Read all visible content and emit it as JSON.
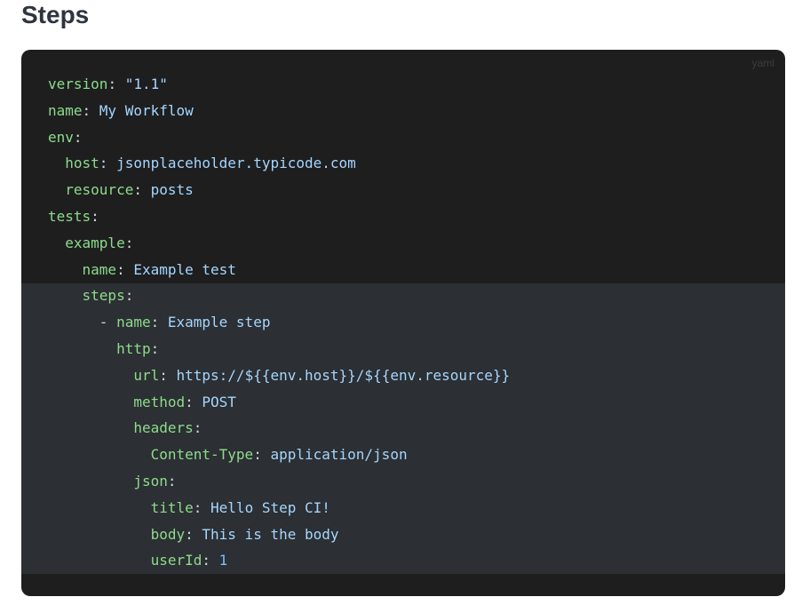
{
  "page": {
    "heading": "Steps"
  },
  "code_block": {
    "language": "yaml",
    "lines": [
      {
        "indent": "",
        "dash": "",
        "key": "version",
        "sep": ": ",
        "value": "\"1.1\"",
        "value_type": "string"
      },
      {
        "indent": "",
        "dash": "",
        "key": "name",
        "sep": ": ",
        "value": "My Workflow",
        "value_type": "string"
      },
      {
        "indent": "",
        "dash": "",
        "key": "env",
        "sep": ":",
        "value": "",
        "value_type": "none"
      },
      {
        "indent": "  ",
        "dash": "",
        "key": "host",
        "sep": ": ",
        "value": "jsonplaceholder.typicode.com",
        "value_type": "string"
      },
      {
        "indent": "  ",
        "dash": "",
        "key": "resource",
        "sep": ": ",
        "value": "posts",
        "value_type": "string"
      },
      {
        "indent": "",
        "dash": "",
        "key": "tests",
        "sep": ":",
        "value": "",
        "value_type": "none"
      },
      {
        "indent": "  ",
        "dash": "",
        "key": "example",
        "sep": ":",
        "value": "",
        "value_type": "none"
      },
      {
        "indent": "    ",
        "dash": "",
        "key": "name",
        "sep": ": ",
        "value": "Example test",
        "value_type": "string"
      },
      {
        "indent": "    ",
        "dash": "",
        "key": "steps",
        "sep": ":",
        "value": "",
        "value_type": "none"
      },
      {
        "indent": "      ",
        "dash": "- ",
        "key": "name",
        "sep": ": ",
        "value": "Example step",
        "value_type": "string"
      },
      {
        "indent": "        ",
        "dash": "",
        "key": "http",
        "sep": ":",
        "value": "",
        "value_type": "none"
      },
      {
        "indent": "          ",
        "dash": "",
        "key": "url",
        "sep": ": ",
        "value": "https://${{env.host}}/${{env.resource}}",
        "value_type": "string"
      },
      {
        "indent": "          ",
        "dash": "",
        "key": "method",
        "sep": ": ",
        "value": "POST",
        "value_type": "string"
      },
      {
        "indent": "          ",
        "dash": "",
        "key": "headers",
        "sep": ":",
        "value": "",
        "value_type": "none"
      },
      {
        "indent": "            ",
        "dash": "",
        "key": "Content-Type",
        "sep": ": ",
        "value": "application/json",
        "value_type": "string"
      },
      {
        "indent": "          ",
        "dash": "",
        "key": "json",
        "sep": ":",
        "value": "",
        "value_type": "none"
      },
      {
        "indent": "            ",
        "dash": "",
        "key": "title",
        "sep": ": ",
        "value": "Hello Step CI!",
        "value_type": "string"
      },
      {
        "indent": "            ",
        "dash": "",
        "key": "body",
        "sep": ": ",
        "value": "This is the body",
        "value_type": "string"
      },
      {
        "indent": "            ",
        "dash": "",
        "key": "userId",
        "sep": ": ",
        "value": "1",
        "value_type": "number"
      }
    ]
  },
  "colors": {
    "code_background": "#1e1e1f",
    "highlight_background": "#2c2f33",
    "key": "#8ddb8c",
    "string": "#a5d6ff",
    "number": "#79c0ff",
    "punctuation": "#d0d7de"
  }
}
